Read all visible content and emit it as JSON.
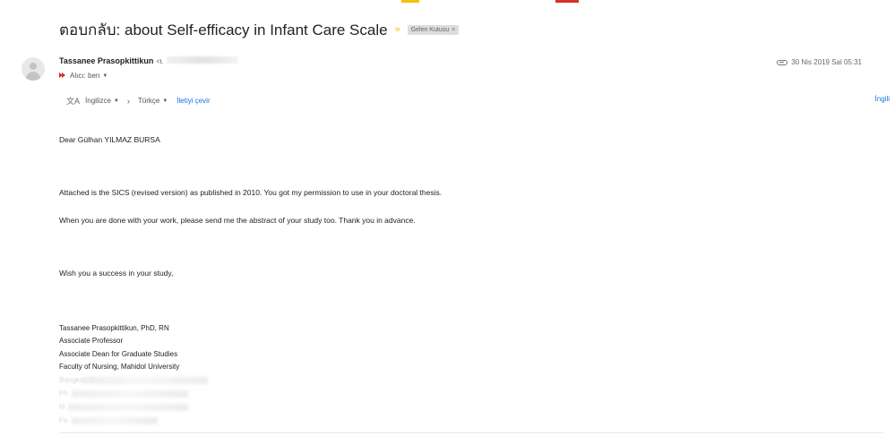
{
  "header": {
    "subject": "ตอบกลับ: about Self-efficacy in Infant Care Scale",
    "label_chip": "Gelen Kutusu",
    "label_close": "×",
    "importance_icon": "importance-marker-icon"
  },
  "sender": {
    "name": "Tassanee Prasopkittikun",
    "email_visible": "<t.",
    "recipient_label": "Alıcı: ben",
    "avatar_icon": "person-avatar-icon"
  },
  "meta": {
    "date": "30 Nis 2019 Sal 05:31"
  },
  "translate": {
    "from_lang": "İngilizce",
    "to_lang": "Türkçe",
    "action": "İletiyi çevir",
    "right_link": "İngili"
  },
  "message": {
    "greeting": "Dear Gülhan YILMAZ BURSA",
    "paragraph1": "Attached is the SICS (revised version) as published in 2010. You got my permission to use in your doctoral thesis.",
    "paragraph2": "When you are done with your work, please send me the abstract of your study too. Thank you in advance.",
    "closing": "Wish you a success in your study,"
  },
  "signature": {
    "name": "Tassanee Prasopkittikun, PhD, RN",
    "title1": "Associate Professor",
    "title2": "Associate Dean for Graduate Studies",
    "org": "Faculty of Nursing, Mahidol University",
    "faded_line1": "Bangkok Th hailand",
    "faded_line2": "Ph",
    "faded_line3": "M",
    "faded_line4": "Fa"
  },
  "colors": {
    "accent_yellow": "#f4c20d",
    "accent_red": "#d93025",
    "link_blue": "#1a73e8",
    "chip_bg": "#dddddd"
  }
}
